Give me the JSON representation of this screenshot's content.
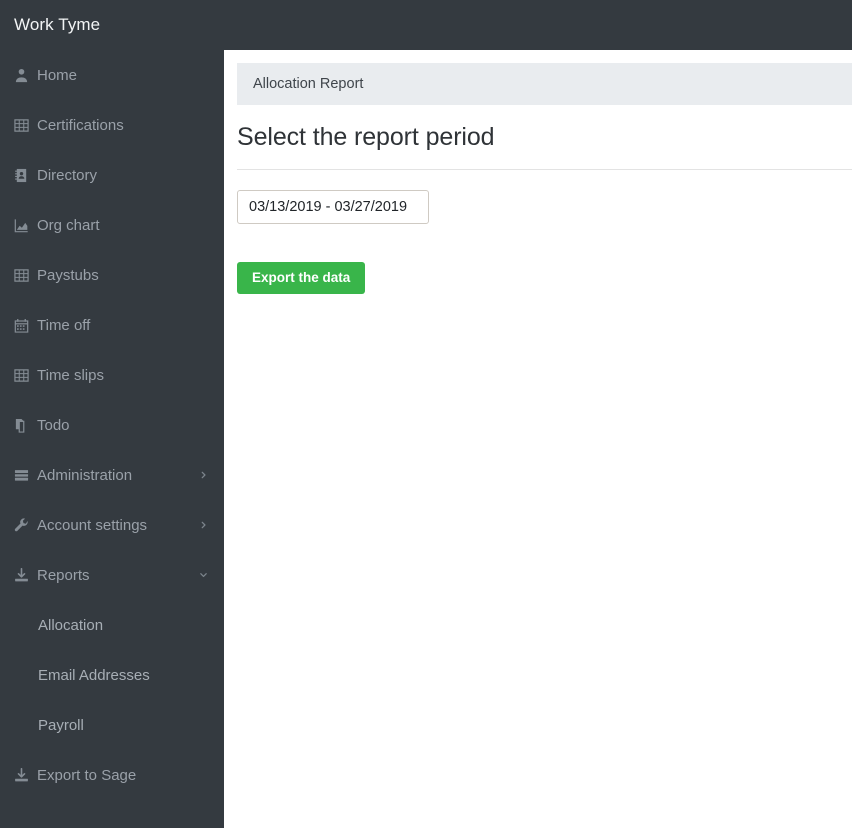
{
  "app": {
    "brand": "Work Tyme",
    "colors": {
      "sidebar_bg": "#343a40",
      "topbar_bg": "#343a40",
      "panel_heading_bg": "#e9ecef",
      "accent_green": "#39b54a",
      "sidebar_text": "#9aa1a9",
      "content_bg": "#ffffff"
    }
  },
  "sidebar": {
    "items": [
      {
        "label": "Home",
        "icon": "user-icon",
        "expandable": false,
        "expanded": false,
        "sub": false
      },
      {
        "label": "Certifications",
        "icon": "table-icon",
        "expandable": false,
        "expanded": false,
        "sub": false
      },
      {
        "label": "Directory",
        "icon": "address-book-icon",
        "expandable": false,
        "expanded": false,
        "sub": false
      },
      {
        "label": "Org chart",
        "icon": "area-chart-icon",
        "expandable": false,
        "expanded": false,
        "sub": false
      },
      {
        "label": "Paystubs",
        "icon": "table-icon",
        "expandable": false,
        "expanded": false,
        "sub": false
      },
      {
        "label": "Time off",
        "icon": "calendar-icon",
        "expandable": false,
        "expanded": false,
        "sub": false
      },
      {
        "label": "Time slips",
        "icon": "table-icon",
        "expandable": false,
        "expanded": false,
        "sub": false
      },
      {
        "label": "Todo",
        "icon": "copy-files-icon",
        "expandable": false,
        "expanded": false,
        "sub": false
      },
      {
        "label": "Administration",
        "icon": "server-list-icon",
        "expandable": true,
        "expanded": false,
        "sub": false
      },
      {
        "label": "Account settings",
        "icon": "wrench-icon",
        "expandable": true,
        "expanded": false,
        "sub": false
      },
      {
        "label": "Reports",
        "icon": "download-icon",
        "expandable": true,
        "expanded": true,
        "sub": false
      },
      {
        "label": "Allocation",
        "icon": "",
        "expandable": false,
        "expanded": false,
        "sub": true
      },
      {
        "label": "Email Addresses",
        "icon": "",
        "expandable": false,
        "expanded": false,
        "sub": true
      },
      {
        "label": "Payroll",
        "icon": "",
        "expandable": false,
        "expanded": false,
        "sub": true
      },
      {
        "label": "Export to Sage",
        "icon": "download-icon",
        "expandable": false,
        "expanded": false,
        "sub": false
      }
    ]
  },
  "main": {
    "panel_heading": "Allocation Report",
    "page_title": "Select the report period",
    "date_range": {
      "value": "03/13/2019 - 03/27/2019",
      "placeholder": "MM/DD/YYYY - MM/DD/YYYY"
    },
    "export_button": "Export the data"
  }
}
